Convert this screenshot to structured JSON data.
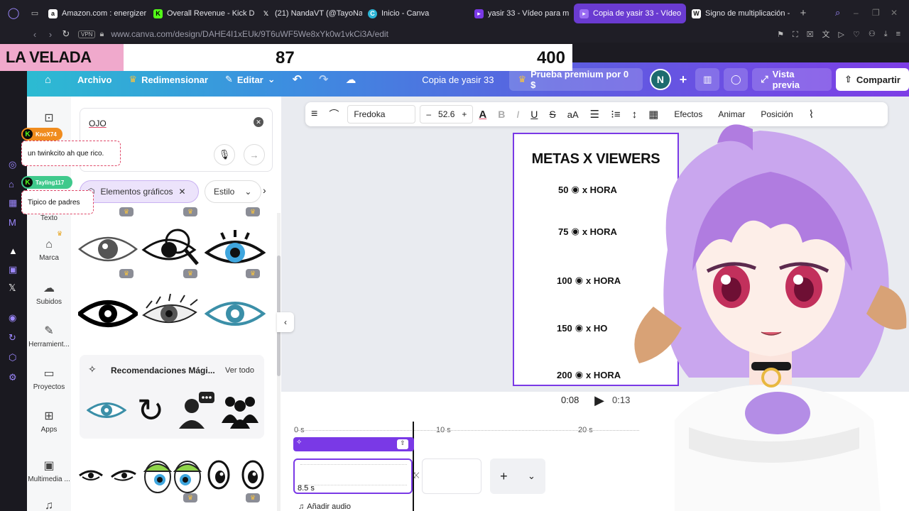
{
  "browser": {
    "tabs": [
      {
        "label": "Amazon.com : energizer",
        "icon": "amazon-icon",
        "active": false
      },
      {
        "label": "Overall Revenue - Kick D",
        "icon": "kick-icon",
        "active": false
      },
      {
        "label": "(21) NandaVT (@TayoNa",
        "icon": "x-icon",
        "active": false
      },
      {
        "label": "Inicio - Canva",
        "icon": "canva-icon",
        "active": false
      },
      {
        "label": "yasir 33 - Vídeo para m",
        "icon": "video-icon",
        "active": false
      },
      {
        "label": "Copia de yasir 33 - Vídeo",
        "icon": "video-icon",
        "active": true
      },
      {
        "label": "Signo de multiplicación -",
        "icon": "wikipedia-icon",
        "active": false
      }
    ],
    "vpn_label": "VPN",
    "url": "www.canva.com/design/DAHE4I1xEUk/9T6uWF5We8xYk0w1vkCi3A/edit"
  },
  "overlay": {
    "event_name": "LA VELADA",
    "value_left": "87",
    "value_right": "400"
  },
  "header": {
    "archivo": "Archivo",
    "redimensionar": "Redimensionar",
    "editar": "Editar",
    "doc_title": "Copia de yasir 33",
    "premium": "Prueba premium por 0 $",
    "avatar_initial": "N",
    "vista_previa": "Vista previa",
    "compartir": "Compartir"
  },
  "rail": {
    "texto": "Texto",
    "marca": "Marca",
    "subidos": "Subidos",
    "herramientas": "Herramient...",
    "proyectos": "Proyectos",
    "apps": "Apps",
    "multimedia": "Multimedia ..."
  },
  "panel": {
    "search_value": "OJO",
    "filter_chip": "Elementos gráficos",
    "style_dropdown": "Estilo",
    "magic_title": "Recomendaciones Mági...",
    "ver_todo": "Ver todo"
  },
  "chat": [
    {
      "user": "KnoX74",
      "message": "un twinkcito ah que rico.",
      "color": "#f08c1e"
    },
    {
      "user": "Tayling117",
      "message": "Tipico de padres",
      "color": "#3fc98c"
    }
  ],
  "toolbar": {
    "font": "Fredoka",
    "font_size": "52.6",
    "efectos": "Efectos",
    "animar": "Animar",
    "posicion": "Posición"
  },
  "design": {
    "title": "METAS X VIEWERS",
    "goals": [
      {
        "num": "50",
        "suffix": "x HORA"
      },
      {
        "num": "75",
        "suffix": "x HORA"
      },
      {
        "num": "100",
        "suffix": "x HORA"
      },
      {
        "num": "150",
        "suffix": "x HO"
      },
      {
        "num": "200",
        "suffix": "x HORA"
      }
    ]
  },
  "playback": {
    "current": "0:08",
    "total": "0:13"
  },
  "timeline": {
    "marks": [
      "0 s",
      "10 s",
      "20 s"
    ],
    "clip_duration": "8.5 s",
    "add_audio": "Añadir audio"
  },
  "colors": {
    "accent": "#7d3ee6",
    "overlay_pink": "#f0a9cc",
    "tab_active": "#6a3bd1"
  }
}
